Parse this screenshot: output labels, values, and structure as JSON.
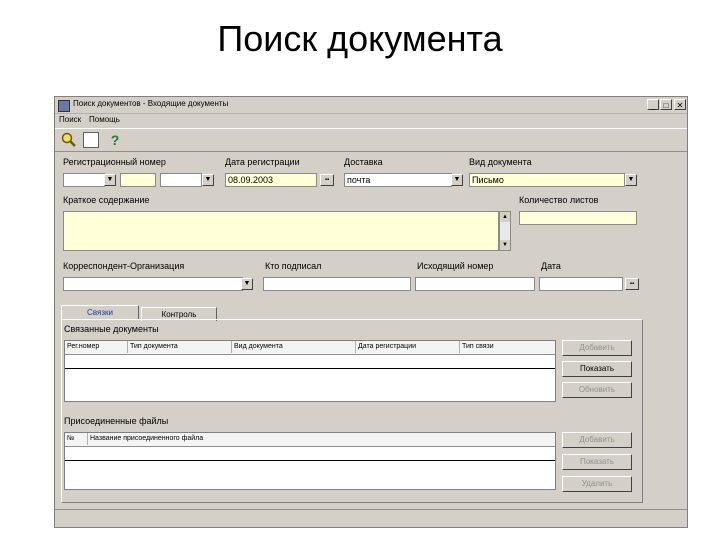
{
  "slide_title": "Поиск документа",
  "window": {
    "title": "Поиск документов - Входящие документы",
    "min_symbol": "_",
    "max_symbol": "□",
    "close_symbol": "✕"
  },
  "menu": [
    "Поиск",
    "Помощь"
  ],
  "toolbar": {
    "help_symbol": "?"
  },
  "form": {
    "reg_number_label": "Регистрационный номер",
    "reg_date_label": "Дата регистрации",
    "reg_date_value": "08.09.2003",
    "delivery_label": "Доставка",
    "delivery_value": "почта",
    "doc_type_label": "Вид документа",
    "doc_type_value": "Письмо",
    "summary_label": "Краткое содержание",
    "sheets_label": "Количество листов",
    "correspondent_label": "Корреспондент-Организация",
    "signed_by_label": "Кто подписал",
    "outgoing_number_label": "Исходящий номер",
    "date_label": "Дата",
    "calendar_symbol": "▪▪"
  },
  "tabs": [
    "Связки",
    "Контроль"
  ],
  "linked": {
    "section_title": "Связанные документы",
    "columns": [
      "Рег.номер",
      "Тип документа",
      "Вид документа",
      "Дата регистрации",
      "Тип связи"
    ],
    "buttons": [
      "Добавить",
      "Показать",
      "Обновить"
    ]
  },
  "files": {
    "section_title": "Присоединенные файлы",
    "columns": [
      "№",
      "Название присоединенного файла"
    ],
    "buttons": [
      "Добавить",
      "Показать",
      "Удалить"
    ]
  }
}
